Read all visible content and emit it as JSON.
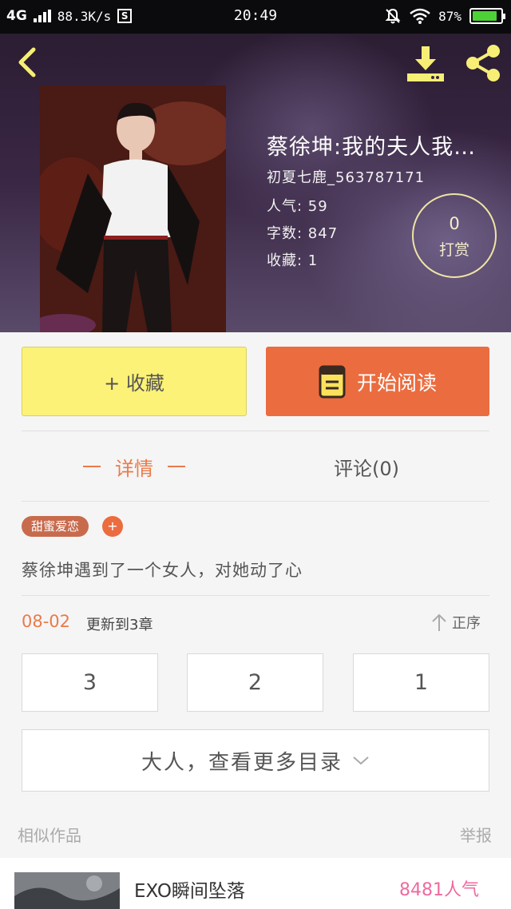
{
  "status_bar": {
    "network": "4G",
    "speed": "88.3K/s",
    "s_badge": "S",
    "time": "20:49",
    "battery": "87%",
    "battery_level": 0.87
  },
  "book": {
    "title": "蔡徐坤:我的夫人我…",
    "author": "初夏七鹿_563787171",
    "popularity": "人气: 59",
    "word_count": "字数: 847",
    "favorites": "收藏: 1",
    "reward_count": "0",
    "reward_label": "打赏"
  },
  "actions": {
    "favorite_label": "+ 收藏",
    "read_label": "开始阅读"
  },
  "tabs": {
    "details": "详情",
    "comments": "评论(0)"
  },
  "tags": [
    "甜蜜爱恋"
  ],
  "tag_add": "+",
  "intro": "蔡徐坤遇到了一个女人，对她动了心",
  "update": {
    "date": "08-02",
    "text": "更新到3章",
    "sort_label": "正序"
  },
  "chapters": [
    "3",
    "2",
    "1"
  ],
  "more_catalog": "大人，查看更多目录",
  "similar": {
    "label": "相似作品",
    "report": "举报",
    "items": [
      {
        "title": "EXO瞬间坠落",
        "popularity": "8481人气"
      }
    ]
  },
  "colors": {
    "accent_orange": "#eb6c3f",
    "favorite_yellow": "#fcf277",
    "popularity_pink": "#f06aa0"
  }
}
